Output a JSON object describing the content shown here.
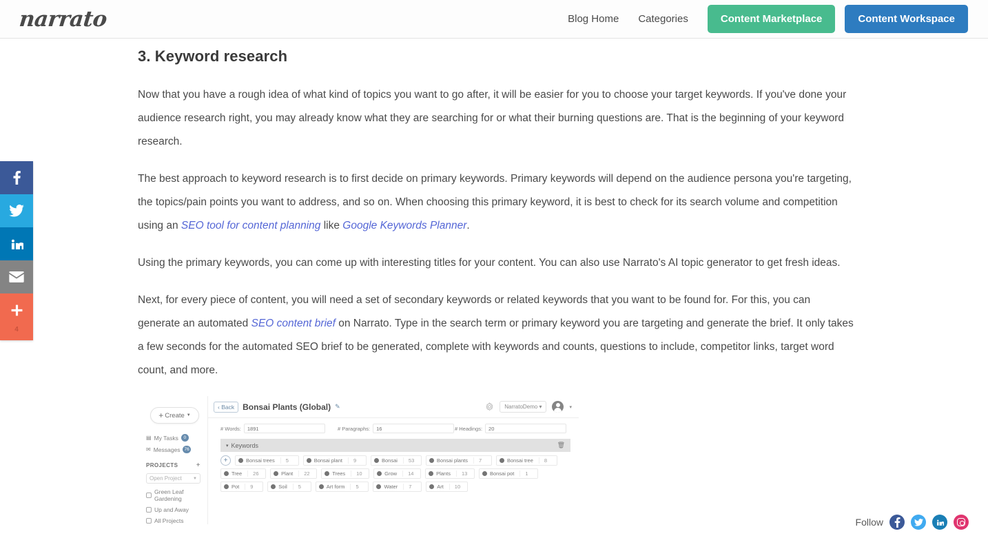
{
  "header": {
    "logo_text": "narrato",
    "nav_links": [
      {
        "label": "Blog Home"
      },
      {
        "label": "Categories"
      }
    ],
    "cta_marketplace": "Content Marketplace",
    "cta_workspace": "Content Workspace",
    "green": "#48bb8e",
    "blue": "#2e7cc0"
  },
  "share_rail": {
    "items": [
      {
        "name": "facebook",
        "color": "#3b5998"
      },
      {
        "name": "twitter",
        "color": "#28a9e0"
      },
      {
        "name": "linkedin",
        "color": "#0077b5"
      },
      {
        "name": "email",
        "color": "#848484"
      },
      {
        "name": "more",
        "color": "#f16a4f"
      }
    ],
    "share_count": "4"
  },
  "article": {
    "section_title": "3. Keyword research",
    "p1": "Now that you have a rough idea of what kind of topics you want to go after, it will be easier for you to choose your target keywords. If you've done your audience research right, you may already know what they are searching for or what their burning questions are. That is the beginning of your keyword research.",
    "p2_a": "The best approach to keyword research is to first decide on primary keywords. Primary keywords will depend on the audience persona you're targeting, the topics/pain points you want to address, and so on. When choosing this primary keyword, it is best to check for its search volume and competition using an ",
    "p2_link1": "SEO tool for content planning",
    "p2_b": " like ",
    "p2_link2": "Google Keywords Planner",
    "p2_c": ".",
    "p3": "Using the primary keywords, you can come up with interesting titles for your content. You can also use Narrato's AI topic generator to get fresh ideas.",
    "p4_a": "Next, for every piece of content, you will need a set of secondary keywords or related keywords that you want to be found for. For this, you can generate an automated ",
    "p4_link": "SEO content brief",
    "p4_b": " on Narrato. Type in the search term or primary keyword you are targeting and generate the brief. It only takes a few seconds for the automated SEO brief to be generated, complete with keywords and counts, questions to include, competitor links, target word count, and more."
  },
  "embed": {
    "sidebar": {
      "create_label": "Create",
      "my_tasks_label": "My Tasks",
      "my_tasks_badge": "0",
      "messages_label": "Messages",
      "messages_badge": "76",
      "projects_header": "PROJECTS",
      "projects_add": "+",
      "open_project_placeholder": "Open Project",
      "projects": [
        {
          "label": "Green Leaf Gardening"
        },
        {
          "label": "Up and Away"
        },
        {
          "label": "All Projects"
        }
      ]
    },
    "topbar": {
      "back_label": "Back",
      "doc_title": "Bonsai Plants (Global)",
      "tenant": "NarratoDemo"
    },
    "stats": [
      {
        "label": "# Words:",
        "value": "1891"
      },
      {
        "label": "# Paragraphs:",
        "value": "16"
      },
      {
        "label": "# Headings:",
        "value": "20"
      }
    ],
    "keywords_section_label": "Keywords",
    "keywords": [
      {
        "term": "Bonsai trees",
        "count": "5"
      },
      {
        "term": "Bonsai plant",
        "count": "9"
      },
      {
        "term": "Bonsai",
        "count": "53"
      },
      {
        "term": "Bonsai plants",
        "count": "7"
      },
      {
        "term": "Bonsai tree",
        "count": "8"
      },
      {
        "term": "Tree",
        "count": "26"
      },
      {
        "term": "Plant",
        "count": "22"
      },
      {
        "term": "Trees",
        "count": "10"
      },
      {
        "term": "Grow",
        "count": "14"
      },
      {
        "term": "Plants",
        "count": "13"
      },
      {
        "term": "Bonsai pot",
        "count": "1"
      },
      {
        "term": "Pot",
        "count": "9"
      },
      {
        "term": "Soil",
        "count": "5"
      },
      {
        "term": "Art form",
        "count": "5"
      },
      {
        "term": "Water",
        "count": "7"
      },
      {
        "term": "Art",
        "count": "10"
      }
    ]
  },
  "follow": {
    "label": "Follow",
    "icons": [
      {
        "name": "facebook"
      },
      {
        "name": "twitter"
      },
      {
        "name": "linkedin"
      },
      {
        "name": "instagram"
      }
    ]
  }
}
